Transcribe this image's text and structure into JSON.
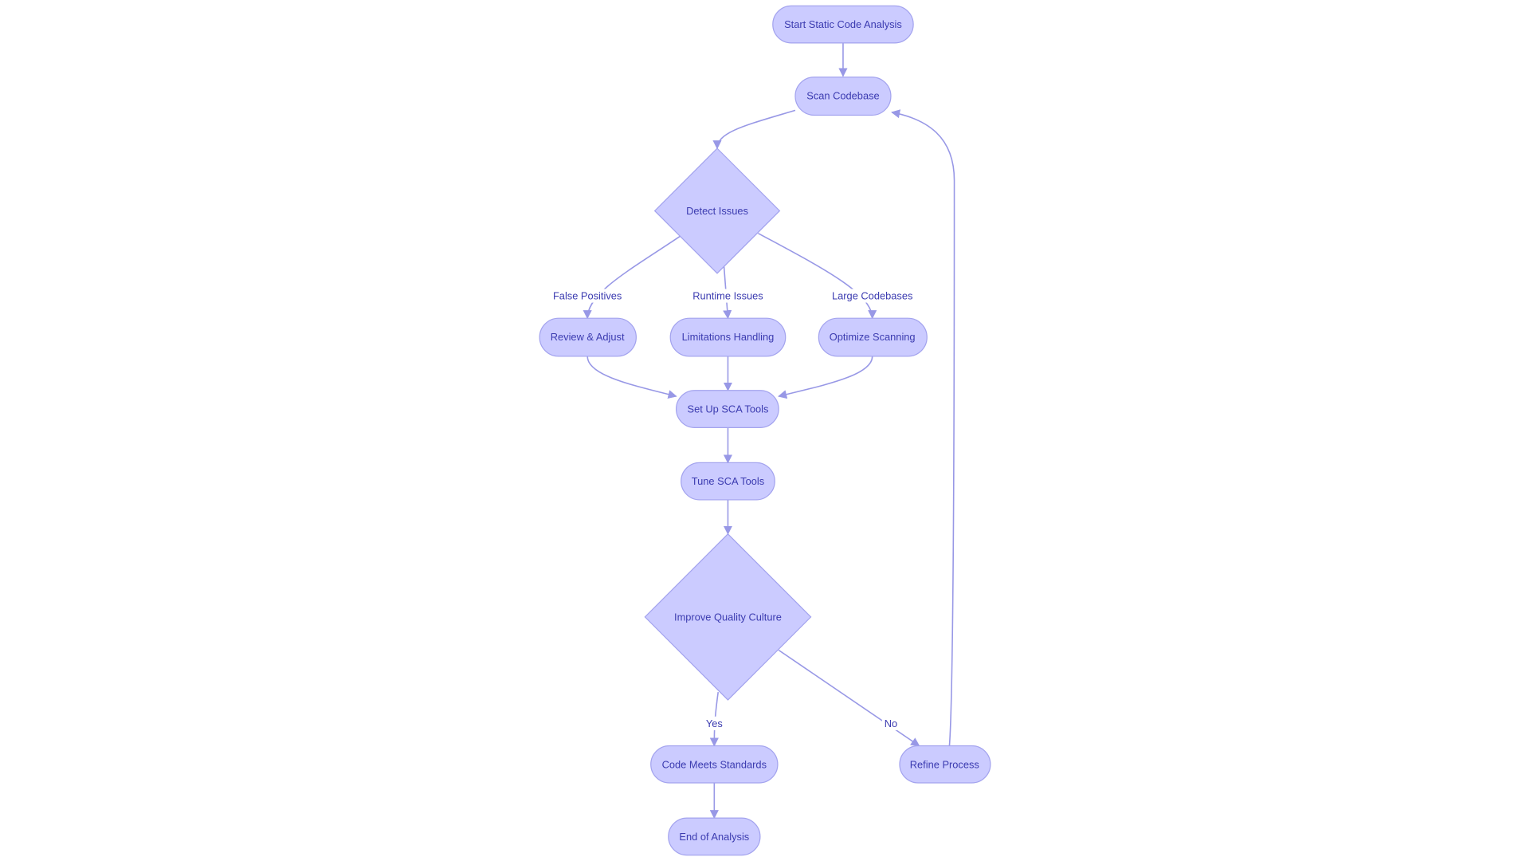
{
  "colors": {
    "node_fill": "#cbcbff",
    "node_stroke": "#a3a3ee",
    "edge": "#9898e6",
    "text": "#3b3bb0"
  },
  "nodes": {
    "start": "Start Static Code Analysis",
    "scan": "Scan Codebase",
    "detect": "Detect Issues",
    "review": "Review & Adjust",
    "limitations": "Limitations Handling",
    "optimize": "Optimize Scanning",
    "setup": "Set Up SCA Tools",
    "tune": "Tune SCA Tools",
    "improve": "Improve Quality Culture",
    "meets": "Code Meets Standards",
    "refine": "Refine Process",
    "end": "End of Analysis"
  },
  "edge_labels": {
    "false_positives": "False Positives",
    "runtime_issues": "Runtime Issues",
    "large_codebases": "Large Codebases",
    "yes": "Yes",
    "no": "No"
  }
}
